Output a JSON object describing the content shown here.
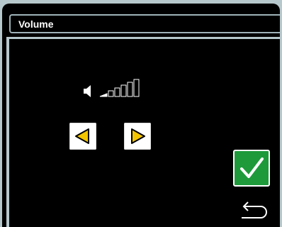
{
  "window": {
    "title": "Volume"
  },
  "volume": {
    "level_bars_filled": 1,
    "level_bars_total": 6
  },
  "icons": {
    "speaker": "speaker-icon",
    "decrease": "triangle-left-icon",
    "increase": "triangle-right-icon",
    "confirm": "check-icon",
    "back": "return-arrow-icon"
  },
  "colors": {
    "background": "#000000",
    "frame": "#b7c8cc",
    "arrow_fill": "#f2c400",
    "confirm_green": "#1e9a3b",
    "button_white": "#ffffff"
  }
}
